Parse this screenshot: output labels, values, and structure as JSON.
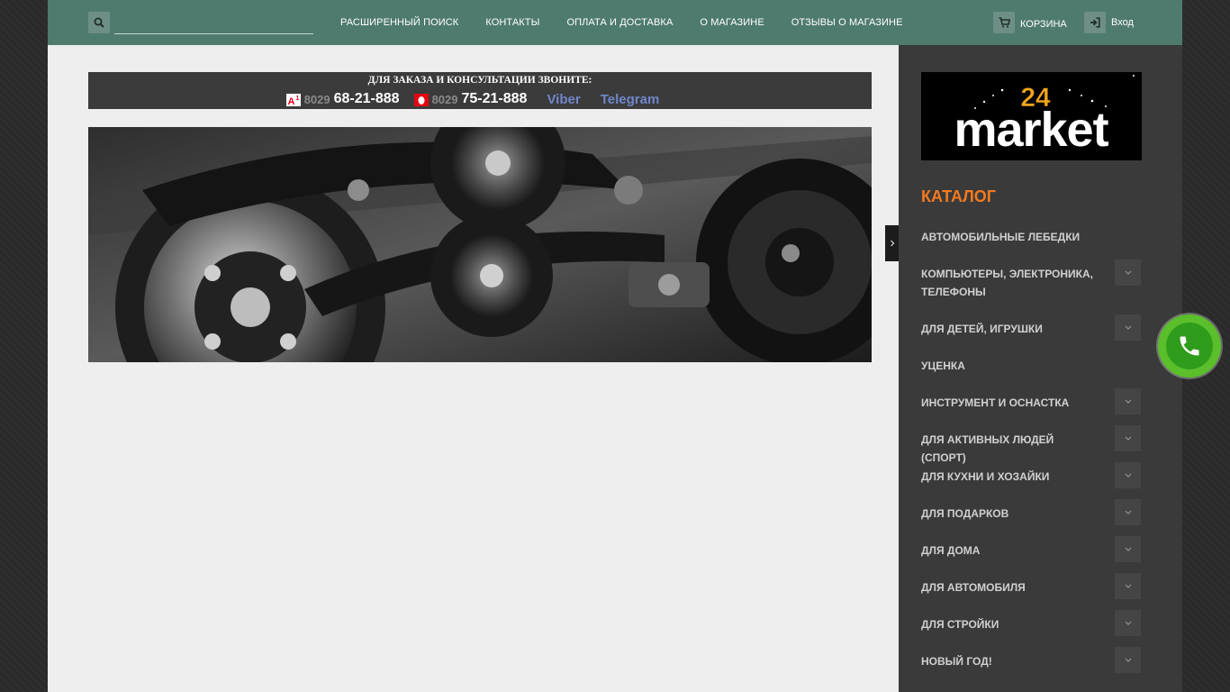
{
  "header": {
    "search": {
      "placeholder": "",
      "value": ""
    },
    "nav": [
      {
        "label": "РАСШИРЕННЫЙ ПОИСК"
      },
      {
        "label": "КОНТАКТЫ"
      },
      {
        "label": "ОПЛАТА И ДОСТАВКА"
      },
      {
        "label": "О МАГАЗИНЕ"
      },
      {
        "label": "ОТЗЫВЫ О МАГАЗИНЕ"
      }
    ],
    "cart_label": "КОРЗИНА",
    "login_label": "Вход"
  },
  "contact": {
    "title": "ДЛЯ ЗАКАЗА И КОНСУЛЬТАЦИИ ЗВОНИТЕ:",
    "phones": [
      {
        "operator_icon": "a1-logo-icon",
        "code": "8029",
        "number": "68-21-888"
      },
      {
        "operator_icon": "mts-logo-icon",
        "code": "8029",
        "number": "75-21-888"
      }
    ],
    "messengers": [
      {
        "label": "Viber"
      },
      {
        "label": "Telegram"
      }
    ]
  },
  "logo": {
    "number": "24",
    "text": "market"
  },
  "catalog": {
    "title": "КАТАЛОГ",
    "items": [
      {
        "label": "АВТОМОБИЛЬНЫЕ ЛЕБЕДКИ"
      },
      {
        "label": "КОМПЬЮТЕРЫ, ЭЛЕКТРОНИКА, ТЕЛЕФОНЫ"
      },
      {
        "label": "ДЛЯ ДЕТЕЙ, ИГРУШКИ"
      },
      {
        "label": "УЦЕНКА"
      },
      {
        "label": "ИНСТРУМЕНТ И ОСНАСТКА"
      },
      {
        "label": "ДЛЯ АКТИВНЫХ ЛЮДЕЙ (СПОРТ)"
      },
      {
        "label": "ДЛЯ КУХНИ И ХОЗАЙКИ"
      },
      {
        "label": "ДЛЯ ПОДАРКОВ"
      },
      {
        "label": "ДЛЯ ДОМА"
      },
      {
        "label": "ДЛЯ АВТОМОБИЛЯ"
      },
      {
        "label": "ДЛЯ СТРОЙКИ"
      },
      {
        "label": "НОВЫЙ ГОД!"
      }
    ]
  },
  "colors": {
    "header": "#4f7b6f",
    "accent": "#f47a1f",
    "sidebar": "#3a3a3a",
    "messenger": "#6f86c9",
    "call": "#5abf2b"
  }
}
